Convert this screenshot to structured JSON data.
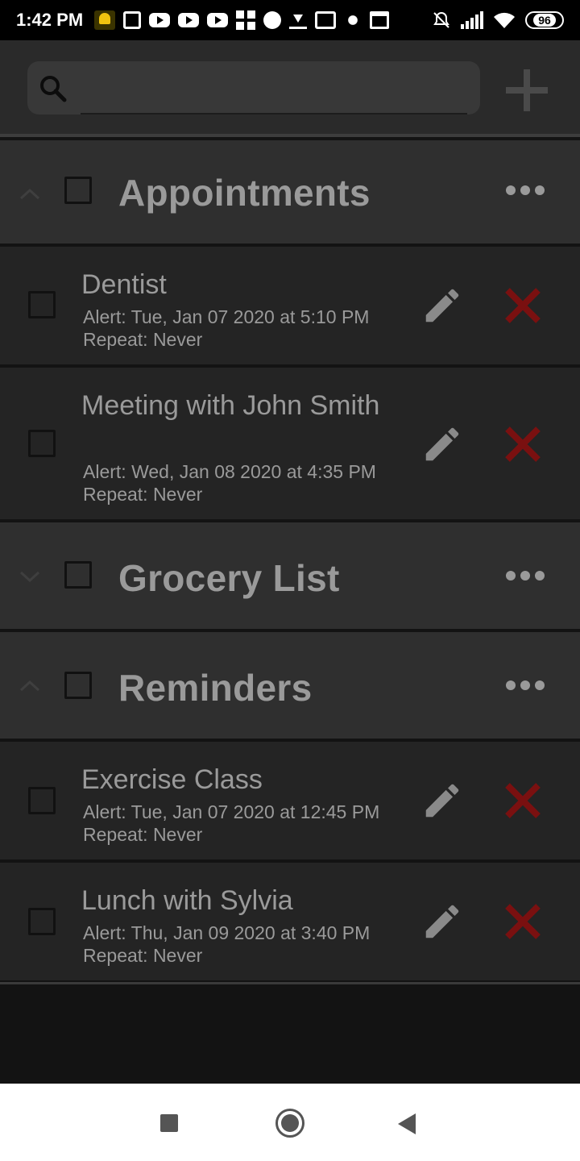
{
  "status_bar": {
    "time": "1:42 PM",
    "battery": "96",
    "icons_left": [
      "bell-icon",
      "news-icon",
      "youtube-icon",
      "youtube-icon",
      "youtube-icon",
      "apps-icon",
      "podcast-icon",
      "download-icon",
      "gmail-icon",
      "pinwheel-icon",
      "calendar-icon"
    ],
    "icons_right": [
      "alarm-off-icon",
      "signal-icon",
      "wifi-icon",
      "battery-icon"
    ]
  },
  "search": {
    "placeholder": "",
    "value": ""
  },
  "colors": {
    "background": "#131313",
    "header": "#2a2a2a",
    "category": "#2f2f2f",
    "item": "#242424",
    "text": "#9a9a9a",
    "delete": "#7a1010",
    "accent": "#9a9a9a"
  },
  "categories": [
    {
      "title": "Appointments",
      "expanded": true,
      "items": [
        {
          "title": "Dentist",
          "alert": "Alert: Tue, Jan 07 2020 at 5:10 PM",
          "repeat": "Repeat: Never"
        },
        {
          "title": "Meeting with John Smith",
          "alert": "Alert: Wed, Jan 08 2020 at 4:35 PM",
          "repeat": "Repeat: Never"
        }
      ]
    },
    {
      "title": "Grocery List",
      "expanded": false,
      "items": []
    },
    {
      "title": "Reminders",
      "expanded": true,
      "items": [
        {
          "title": "Exercise Class",
          "alert": "Alert: Tue, Jan 07 2020 at 12:45 PM",
          "repeat": "Repeat: Never"
        },
        {
          "title": "Lunch with Sylvia",
          "alert": "Alert: Thu, Jan 09 2020 at 3:40 PM",
          "repeat": "Repeat: Never"
        }
      ]
    }
  ],
  "nav_bar": {
    "buttons": [
      "recents-icon",
      "home-icon",
      "back-icon"
    ]
  }
}
